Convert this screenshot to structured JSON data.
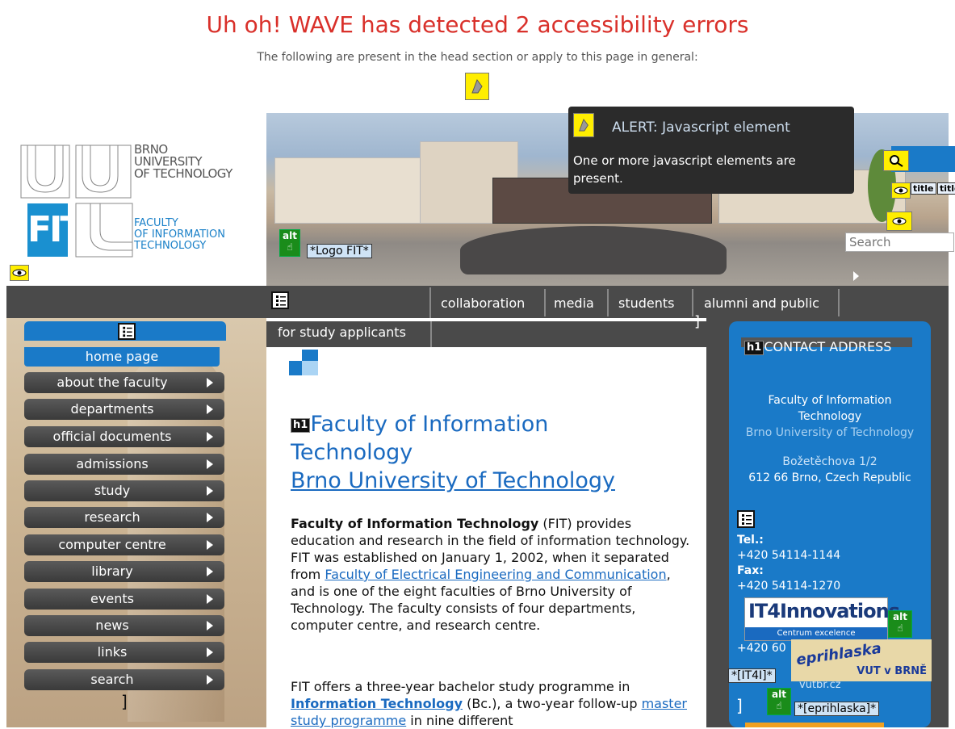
{
  "wave": {
    "title": "Uh oh! WAVE has detected 2 accessibility errors",
    "subtitle": "The following are present in the head section or apply to this page in general:",
    "alert_title": "ALERT: Javascript element",
    "alert_text": "One or more javascript elements are present."
  },
  "header": {
    "university_line1": "BRNO",
    "university_line2": "UNIVERSITY",
    "university_line3": "OF TECHNOLOGY",
    "faculty_line1": "FACULTY",
    "faculty_line2": "OF INFORMATION",
    "faculty_line3": "TECHNOLOGY",
    "logo_tag": "*Logo FIT*",
    "search_placeholder": "Search",
    "title_tag": "title",
    "title_tag2": "title"
  },
  "top_menu": {
    "items": [
      "collaboration",
      "media",
      "students",
      "alumni and public",
      "for study applicants"
    ]
  },
  "left_menu": {
    "items": [
      "home page",
      "about the faculty",
      "departments",
      "official documents",
      "admissions",
      "study",
      "research",
      "computer centre",
      "library",
      "events",
      "news",
      "links",
      "search"
    ]
  },
  "main": {
    "heading_line1": "Faculty of Information",
    "heading_line2": "Technology",
    "heading_line3": "Brno University of Technology",
    "p1_bold": "Faculty of Information Technology",
    "p1_a": " (FIT) provides education and research in the field of information technology. FIT was established on January 1, 2002, when it separated from ",
    "p1_link": "Faculty of Electrical Engineering and Communication",
    "p1_b": ", and is one of the eight faculties of Brno University of Technology. The faculty consists of four departments, computer centre, and research centre.",
    "p2_a": "FIT offers a three-year bachelor study programme in ",
    "p2_link1": "Information Technology",
    "p2_b": " (Bc.), a two-year follow-up ",
    "p2_link2": "master study programme",
    "p2_c": " in nine different"
  },
  "contact": {
    "heading": "CONTACT ADDRESS",
    "line1": "Faculty of Information",
    "line2": "Technology",
    "line3": "Brno University of Technology",
    "address1": "Božetěchova 1/2",
    "address2": "612 66 Brno, Czech Republic",
    "tel_label": "Tel.:",
    "tel": "+420 54114-1144",
    "fax_label": "Fax:",
    "fax": "+420 54114-1270",
    "gsm_partial": "+420 60",
    "email_partial": "vutbr.cz",
    "it4_logo": "IT4Innovations",
    "it4_sub": "Centrum excelence",
    "it4_tag": "*[IT4I]*",
    "eprihlaska_logo": "eprihlaska",
    "eprihlaska_sub": "VUT v BRNĚ",
    "eprihlaska_tag": "*[eprihlaska]*",
    "alt_label": "alt"
  },
  "colors": {
    "wave_error": "#d9302a",
    "contact_bg": "#1a7ac8",
    "menu_dark": "#4a4a4a",
    "link": "#1a6ac0"
  }
}
